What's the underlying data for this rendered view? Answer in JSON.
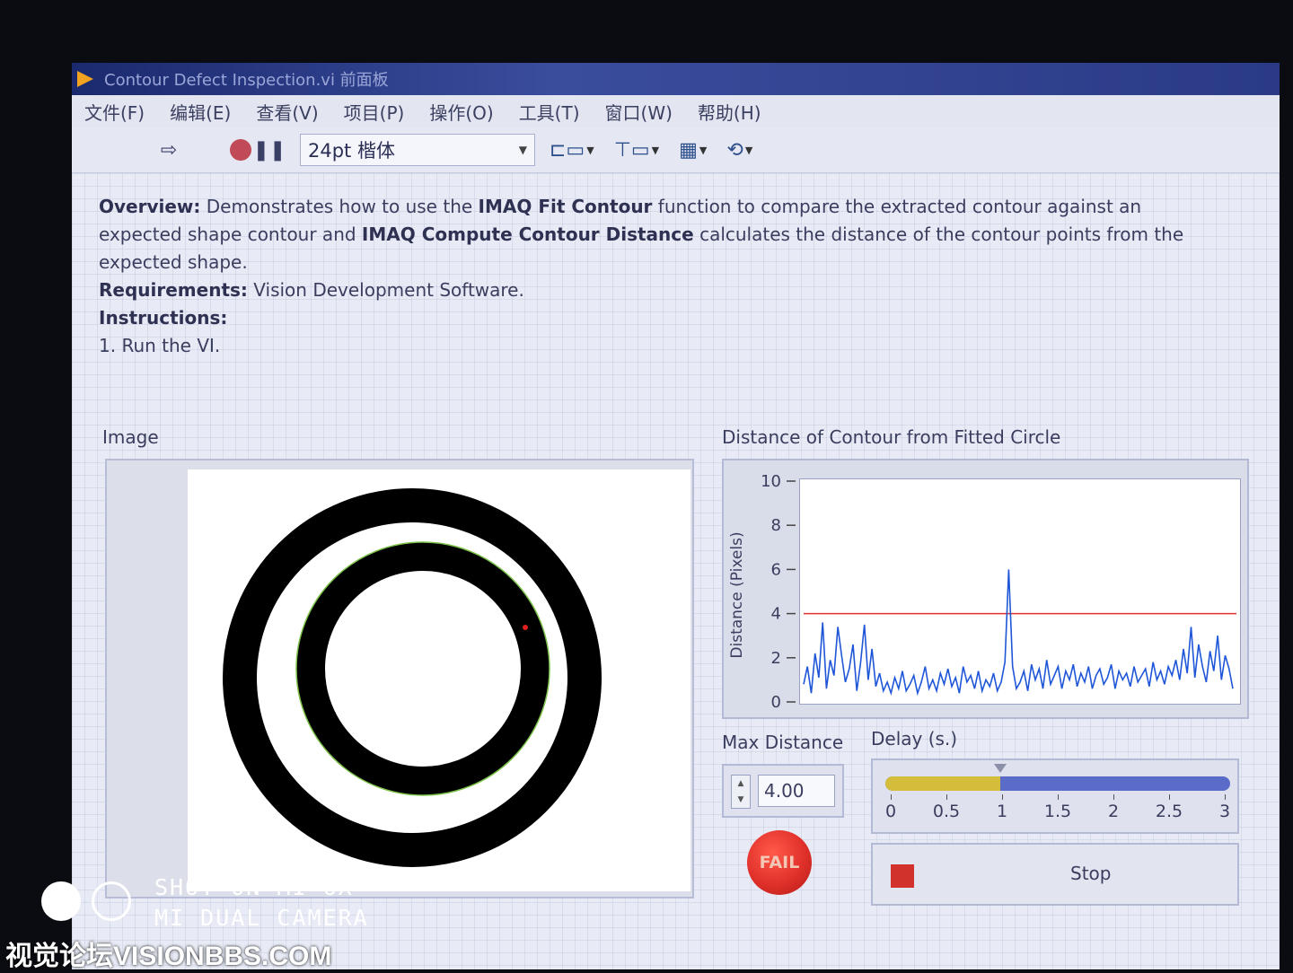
{
  "window": {
    "title": "Contour Defect Inspection.vi 前面板"
  },
  "menu": [
    "文件(F)",
    "编辑(E)",
    "查看(V)",
    "项目(P)",
    "操作(O)",
    "工具(T)",
    "窗口(W)",
    "帮助(H)"
  ],
  "toolbar": {
    "font_setting": "24pt 楷体"
  },
  "description": {
    "overview_label": "Overview:",
    "overview_text_1": " Demonstrates how to use the ",
    "fit_contour": "IMAQ Fit Contour",
    "overview_text_2": " function to compare the extracted contour against an expected shape contour and ",
    "compute_distance": "IMAQ Compute Contour Distance",
    "overview_text_3": " calculates the distance of the contour points from the expected shape.",
    "requirements_label": "Requirements:",
    "requirements_text": " Vision Development Software.",
    "instructions_label": "Instructions:",
    "step1": "1. Run the VI."
  },
  "image_display": {
    "label": "Image"
  },
  "graph": {
    "title": "Distance of Contour from Fitted Circle",
    "ylabel": "Distance (Pixels)"
  },
  "max_distance": {
    "label": "Max Distance",
    "value": "4.00"
  },
  "delay": {
    "label": "Delay (s.)",
    "ticks": [
      "0",
      "0.5",
      "1",
      "1.5",
      "2",
      "2.5",
      "3"
    ],
    "value": 1,
    "min": 0,
    "max": 3
  },
  "status": {
    "fail_label": "FAIL"
  },
  "stop_button": {
    "label": "Stop"
  },
  "watermark": {
    "line1": "SHOT ON MI 6X",
    "line2": "MI DUAL CAMERA",
    "site": "视觉论坛VISIONBBS.COM"
  },
  "colors": {
    "threshold_line": "#e03030",
    "series": "#1f56d8",
    "fail": "#e0302a"
  },
  "chart_data": {
    "type": "line",
    "title": "Distance of Contour from Fitted Circle",
    "xlabel": "",
    "ylabel": "Distance (Pixels)",
    "ylim": [
      0,
      10
    ],
    "yticks": [
      "0",
      "2",
      "4",
      "6",
      "8",
      "10"
    ],
    "grid": false,
    "threshold": 4.0,
    "series": [
      {
        "values": [
          0.8,
          1.6,
          0.4,
          2.2,
          1.1,
          3.6,
          0.6,
          1.9,
          1.2,
          3.4,
          2.1,
          0.9,
          1.5,
          2.6,
          0.5,
          1.8,
          3.5,
          1.0,
          2.4,
          0.7,
          1.3,
          0.5,
          0.9,
          0.4,
          1.1,
          0.6,
          1.4,
          0.5,
          0.8,
          1.2,
          0.4,
          0.9,
          1.6,
          0.6,
          1.0,
          0.5,
          1.3,
          0.8,
          1.5,
          0.7,
          1.1,
          0.4,
          1.6,
          0.9,
          1.2,
          0.6,
          1.4,
          0.5,
          1.0,
          0.7,
          1.3,
          0.5,
          0.9,
          1.8,
          6.0,
          1.6,
          0.6,
          0.9,
          1.4,
          0.5,
          1.7,
          1.0,
          1.5,
          0.6,
          1.9,
          0.8,
          1.2,
          1.6,
          0.6,
          1.4,
          1.0,
          1.7,
          0.7,
          1.3,
          0.9,
          1.6,
          0.6,
          1.2,
          1.5,
          0.8,
          1.1,
          1.7,
          0.6,
          1.4,
          1.0,
          1.3,
          0.7,
          1.6,
          0.9,
          1.2,
          1.5,
          0.7,
          1.8,
          1.0,
          1.4,
          0.8,
          1.6,
          1.2,
          1.9,
          1.0,
          2.4,
          1.3,
          3.4,
          1.1,
          2.6,
          1.6,
          0.9,
          2.3,
          1.4,
          3.0,
          1.0,
          2.1,
          1.5,
          0.6
        ]
      }
    ]
  }
}
